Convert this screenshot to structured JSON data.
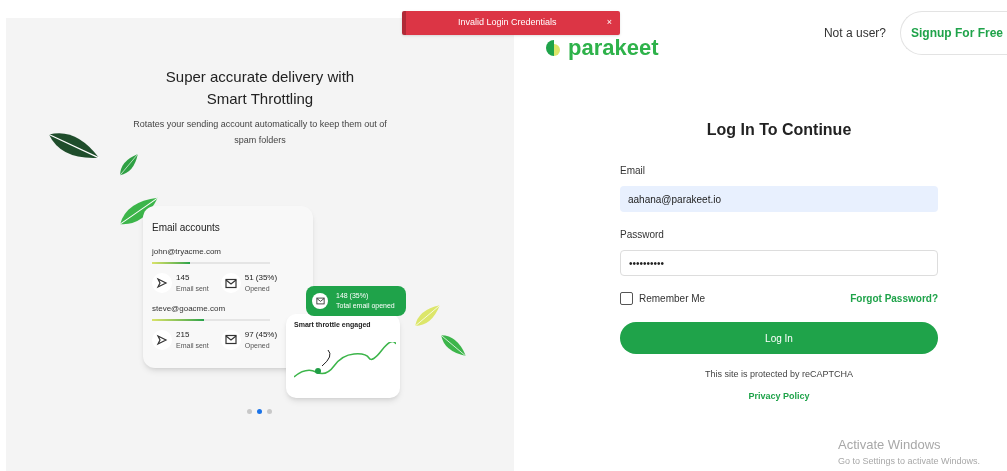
{
  "toast": {
    "message": "Invalid Login Credentials",
    "close": "×"
  },
  "promo": {
    "title": "Super accurate delivery with Smart Throttling",
    "subtitle": "Rotates your sending account automatically to keep them out of spam folders",
    "card": {
      "title": "Email accounts",
      "accounts": [
        {
          "email": "john@tryacme.com",
          "level": 0.32,
          "sent": "145",
          "sent_label": "Email sent",
          "opened": "51 (35%)",
          "opened_label": "Opened"
        },
        {
          "email": "steve@goacme.com",
          "level": 0.44,
          "sent": "215",
          "sent_label": "Email sent",
          "opened": "97 (45%)",
          "opened_label": "Opened"
        }
      ]
    },
    "total": {
      "value": "148 (35%)",
      "label": "Total email opened"
    },
    "chart_card": {
      "label": "Smart throttle engaged"
    },
    "dots": [
      {
        "selected": false
      },
      {
        "selected": true
      },
      {
        "selected": false
      }
    ]
  },
  "header": {
    "logo": "parakeet",
    "prompt": "Not a user?",
    "signup": "Signup For Free"
  },
  "form": {
    "title": "Log In To Continue",
    "email_label": "Email",
    "email_value": "aahana@parakeet.io",
    "password_label": "Password",
    "password_value": "••••••••••",
    "remember": {
      "label": "Remember Me",
      "checked": false
    },
    "forgot": "Forgot Password?",
    "submit": "Log In",
    "recaptcha": "This site is protected by reCAPTCHA",
    "privacy": "Privacy Policy"
  },
  "os_notice": {
    "title": "Activate Windows",
    "text": "Go to Settings to activate Windows."
  }
}
